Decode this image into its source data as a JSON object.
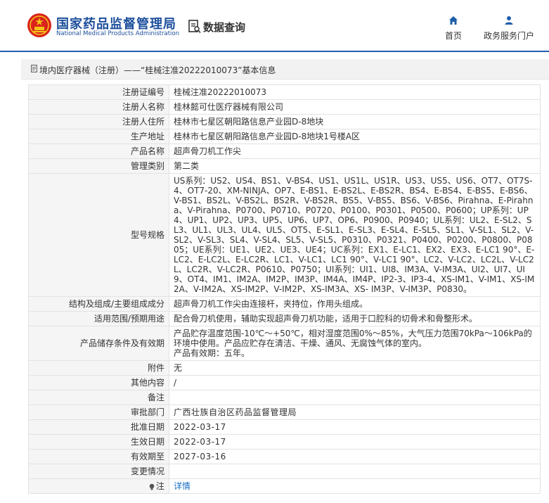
{
  "header": {
    "logo_cn": "国家药品监督管理局",
    "logo_en": "National Medical Products Administration",
    "data_query": "数据查询",
    "nav": {
      "home": "首页",
      "service": "政务服务门户"
    }
  },
  "section": {
    "title": "境内医疗器械（注册）——“桂械注准20222010073”基本信息"
  },
  "rows": [
    {
      "label": "注册证编号",
      "value": "桂械注准20222010073"
    },
    {
      "label": "注册人名称",
      "value": "桂林懿可仕医疗器械有限公司"
    },
    {
      "label": "注册人住所",
      "value": "桂林市七星区朝阳路信息产业园D-8地块"
    },
    {
      "label": "生产地址",
      "value": "桂林市七星区朝阳路信息产业园D-8地块1号楼A区"
    },
    {
      "label": "产品名称",
      "value": "超声骨刀机工作尖"
    },
    {
      "label": "管理类别",
      "value": "第二类"
    },
    {
      "label": "型号规格",
      "value": "US系列：US2、US4、BS1、V-BS4、US1、US1L、US1R、US3、US5、US6、OT7、OT7S-4、OT7-20、XM-NINJA、OP7、E-BS1、E-BS2L、E-BS2R、BS4、E-BS4、E-BS5、E-BS6、V-BS1、BS2L、V-BS2L、BS2R、V-BS2R、BS5、V-BS5、BS6、V-BS6、Pirahna、E-Pirahna、V-Pirahna、P0700、P0710、P0720、P0100、P0301、P0500、P0600；UP系列：UP4、UP1、UP2、UP3、UP5、UP6、UP7、OP6、P0900、P0940；UL系列：UL2、E-SL2、SL3、UL1、UL3、UL4、UL5、OT5、E-SL1、E-SL3、E-SL4、E-SL5、SL1、V-SL1、SL2、V-SL2、V-SL3、SL4、V-SL4、SL5、V-SL5、P0310、P0321、P0400、P0200、P0800、P0805；UE系列：UE1、UE2、UE3、UE4；UC系列：EX1、E-LC1、EX2、EX3、E-LC1 90°、E-LC2、E-LC2L、E-LC2R、LC1、V-LC1、LC1 90°、V-LC1 90°、LC2、V-LC2、LC2L、V-LC2L、LC2R、V-LC2R、P0610、P0750；UI系列：UI1、UI8、IM3A、V-IM3A、UI2、UI7、UI9、OT4、IM1、IM2A、IM2P、IM3P、IM4A、IM4P、IP2-3、IP3-4、XS-IM1、V-IM1、XS-IM2A、V-IM2A、XS-IM2P、V-IM2P、XS-IM3A、XS- IM3P、V-IM3P、P0830。"
    },
    {
      "label": "结构及组成/主要组成成分",
      "value": "超声骨刀机工作尖由连接杆，夹持位，作用头组成。"
    },
    {
      "label": "适用范围/预期用途",
      "value": "配合骨刀机使用，辅助实现超声骨刀机功能，适用于口腔科的切骨术和骨整形术。"
    },
    {
      "label": "产品储存条件及有效期",
      "value_lines": [
        "产品贮存温度范围-10℃～+50℃，相对湿度范围0%～85%，大气压力范围70kPa～106kPa的环境中使用。产品应贮存在清洁、干燥、通风、无腐蚀气体的室内。",
        "产品有效期：五年。"
      ]
    },
    {
      "label": "附件",
      "value": "无"
    },
    {
      "label": "其他内容",
      "value": "/"
    },
    {
      "label": "备注",
      "value": ""
    },
    {
      "label": "审批部门",
      "value": "广西壮族自治区药品监督管理局"
    },
    {
      "label": "批准日期",
      "value": "2022-03-17"
    },
    {
      "label": "生效日期",
      "value": "2022-03-17"
    },
    {
      "label": "有效期至",
      "value": "2027-03-16"
    },
    {
      "label": "变更情况",
      "value": ""
    },
    {
      "label": "注",
      "value": "详情"
    }
  ],
  "colors": {
    "brand_blue": "#1d4f9c",
    "link": "#1a6ec2",
    "header_line": "#1f5ea8"
  }
}
